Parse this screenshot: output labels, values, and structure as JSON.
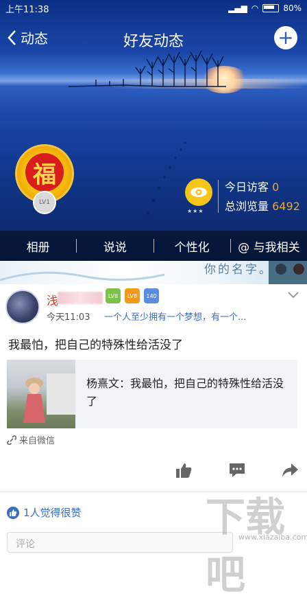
{
  "status_bar": {
    "time": "上午11:38",
    "battery": "80%"
  },
  "top_bar": {
    "back_label": "动态",
    "title": "好友动态"
  },
  "profile": {
    "level_badge": "LV1"
  },
  "visitors": {
    "today_label": "今日访客",
    "today_value": "0",
    "total_label": "总浏览量",
    "total_value": "6492"
  },
  "tabs": [
    "相册",
    "说说",
    "个性化",
    "与我相关"
  ],
  "banner": {
    "text": "你的名字。"
  },
  "post": {
    "username_visible": "浅",
    "badges": [
      "LV8",
      "LV8",
      "140"
    ],
    "time": "今天11:03",
    "signature": "一个人至少拥有一个梦想，有一个...",
    "text": "我最怕，把自己的特殊性给活没了",
    "share_text": "杨熹文：我最怕，把自己的特殊性给活没了",
    "source": "来自微信"
  },
  "likes": {
    "text": "1人觉得很赞"
  },
  "comment": {
    "placeholder": "评论"
  },
  "watermark": {
    "text": "下载吧",
    "url": "www.xiazaiba.com"
  },
  "colors": {
    "accent_blue": "#3b6fc4",
    "visitor_number": "#f5a623",
    "username": "#e6352b"
  }
}
